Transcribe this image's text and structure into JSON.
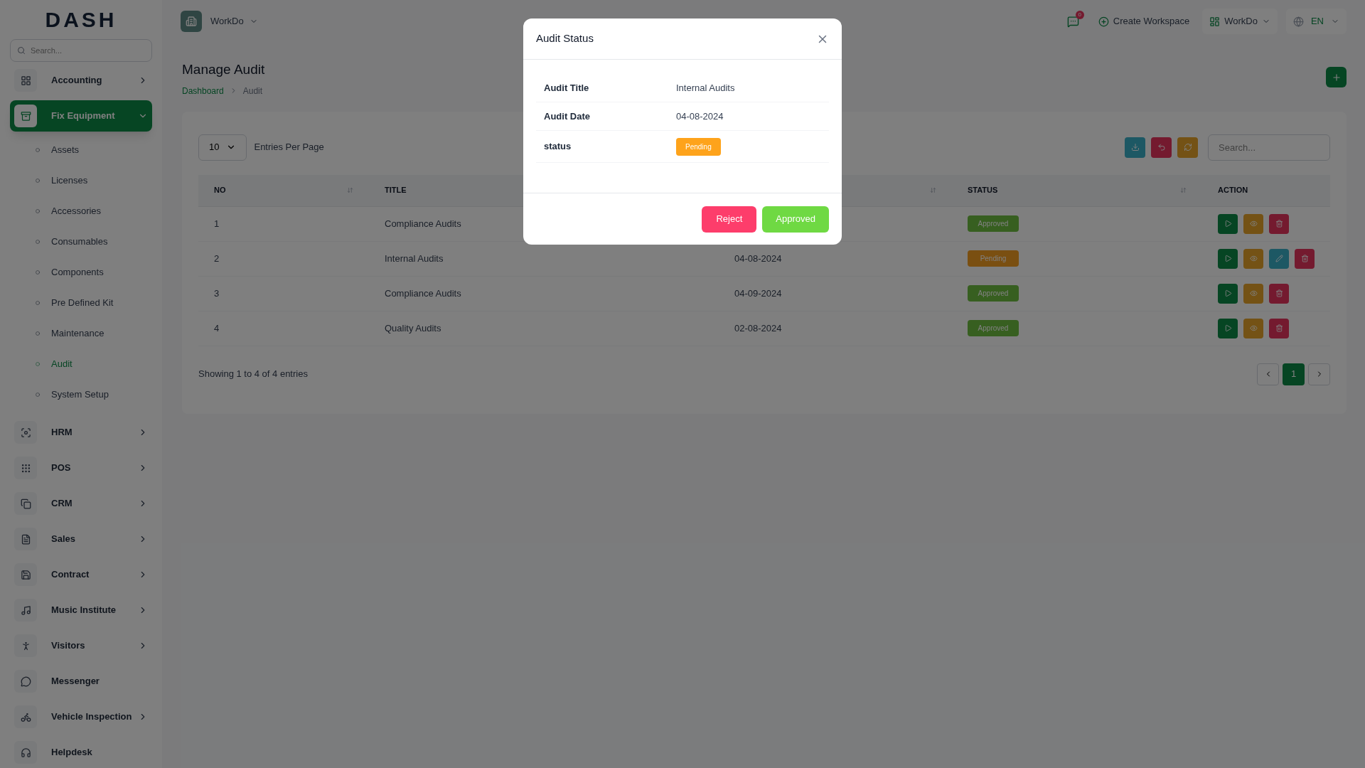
{
  "sidebar": {
    "logo": "DASH",
    "search": {
      "placeholder": "Search..."
    },
    "items": [
      {
        "label": "Accounting",
        "kind": "module",
        "expanded": false,
        "selected": false
      },
      {
        "label": "Fix Equipment",
        "kind": "module",
        "expanded": true,
        "selected": true,
        "children": [
          {
            "label": "Assets",
            "selected": false
          },
          {
            "label": "Licenses",
            "selected": false
          },
          {
            "label": "Accessories",
            "selected": false
          },
          {
            "label": "Consumables",
            "selected": false
          },
          {
            "label": "Components",
            "selected": false
          },
          {
            "label": "Pre Defined Kit",
            "selected": false
          },
          {
            "label": "Maintenance",
            "selected": false
          },
          {
            "label": "Audit",
            "selected": true
          },
          {
            "label": "System Setup",
            "selected": false
          }
        ]
      },
      {
        "label": "HRM",
        "kind": "module",
        "expanded": false,
        "selected": false
      },
      {
        "label": "POS",
        "kind": "module",
        "expanded": false,
        "selected": false
      },
      {
        "label": "CRM",
        "kind": "module",
        "expanded": false,
        "selected": false
      },
      {
        "label": "Sales",
        "kind": "module",
        "expanded": false,
        "selected": false
      },
      {
        "label": "Contract",
        "kind": "module",
        "expanded": false,
        "selected": false
      },
      {
        "label": "Music Institute",
        "kind": "module",
        "expanded": false,
        "selected": false
      },
      {
        "label": "Visitors",
        "kind": "module",
        "expanded": false,
        "selected": false
      },
      {
        "label": "Messenger",
        "kind": "link",
        "selected": false
      },
      {
        "label": "Vehicle Inspection",
        "kind": "module",
        "expanded": false,
        "selected": false
      },
      {
        "label": "Helpdesk",
        "kind": "link",
        "selected": false
      }
    ]
  },
  "topbar": {
    "workspace": "WorkDo",
    "notifications": "0",
    "create": "Create Workspace",
    "account": "WorkDo",
    "language": "EN"
  },
  "page": {
    "title": "Manage Audit",
    "breadcrumb": [
      "Dashboard",
      "Audit"
    ]
  },
  "table": {
    "page_size": "10",
    "page_size_label": "Entries Per Page",
    "search": {
      "placeholder": "Search..."
    },
    "columns": [
      {
        "label": "NO",
        "sortable": true
      },
      {
        "label": "TITLE",
        "sortable": false
      },
      {
        "sortable": true
      },
      {
        "label": "STATUS",
        "sortable": true
      },
      {
        "label": "ACTION",
        "sortable": false
      }
    ],
    "rows": [
      {
        "no": "1",
        "title": "Compliance Audits",
        "status": {
          "text": "Approved",
          "kind": "approved"
        },
        "actions": [
          {
            "kind": "run"
          },
          {
            "kind": "view"
          },
          {
            "kind": "delete"
          }
        ]
      },
      {
        "no": "2",
        "title": "Internal Audits",
        "date": "04-08-2024",
        "status": {
          "text": "Pending",
          "kind": "pending"
        },
        "actions": [
          {
            "kind": "run"
          },
          {
            "kind": "view"
          },
          {
            "kind": "edit"
          },
          {
            "kind": "delete"
          }
        ]
      },
      {
        "no": "3",
        "title": "Compliance Audits",
        "date": "04-09-2024",
        "status": {
          "text": "Approved",
          "kind": "approved"
        },
        "actions": [
          {
            "kind": "run"
          },
          {
            "kind": "view"
          },
          {
            "kind": "delete"
          }
        ]
      },
      {
        "no": "4",
        "title": "Quality Audits",
        "date": "02-08-2024",
        "status": {
          "text": "Approved",
          "kind": "approved"
        },
        "actions": [
          {
            "kind": "run"
          },
          {
            "kind": "view"
          },
          {
            "kind": "delete"
          }
        ]
      }
    ],
    "summary": "Showing 1 to 4 of 4 entries",
    "pages": [
      {
        "label": "1",
        "selected": true
      }
    ]
  },
  "modal": {
    "title": "Audit Status",
    "fields": [
      {
        "label": "Audit Title",
        "kind": "text",
        "value": "Internal Audits"
      },
      {
        "label": "Audit Date",
        "kind": "text",
        "value": "04-08-2024"
      },
      {
        "label": "status",
        "kind": "badge",
        "value": "Pending",
        "color": "#fea31b"
      }
    ],
    "buttons": [
      {
        "label": "Reject",
        "kind": "danger"
      },
      {
        "label": "Approved",
        "kind": "success"
      }
    ]
  }
}
